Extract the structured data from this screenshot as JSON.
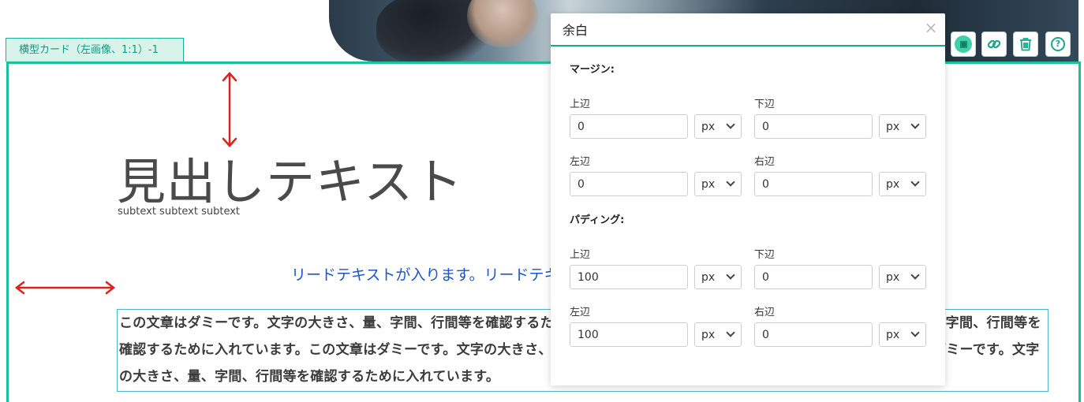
{
  "card": {
    "label": "横型カード（左画像、1:1）-1"
  },
  "content": {
    "heading": "見出しテキスト",
    "subtext": "subtext subtext subtext",
    "lead": "リードテキストが入ります。リードテキ",
    "body": "この文章はダミーです。文字の大きさ、量、字間、行間等を確認するために入れています。この文章はダミーです。文字の大きさ、量、字間、行間等を確認するために入れています。この文章はダミーです。文字の大きさ、量、字間、行間等を確認するために入れています。この文章はダミーです。文字の大きさ、量、字間、行間等を確認するために入れています。"
  },
  "toolbar": {
    "margin_icon": "margin-settings-icon",
    "link_icon": "link-icon",
    "delete_icon": "trash-icon",
    "help_label": "?"
  },
  "dialog": {
    "title": "余白",
    "close_label": "×",
    "margin": {
      "title": "マージン:",
      "top": {
        "label": "上辺",
        "value": "0",
        "unit": "px"
      },
      "bottom": {
        "label": "下辺",
        "value": "0",
        "unit": "px"
      },
      "left": {
        "label": "左辺",
        "value": "0",
        "unit": "px"
      },
      "right": {
        "label": "右辺",
        "value": "0",
        "unit": "px"
      }
    },
    "padding": {
      "title": "パディング:",
      "top": {
        "label": "上辺",
        "value": "100",
        "unit": "px"
      },
      "bottom": {
        "label": "下辺",
        "value": "0",
        "unit": "px"
      },
      "left": {
        "label": "左辺",
        "value": "100",
        "unit": "px"
      },
      "right": {
        "label": "右辺",
        "value": "0",
        "unit": "px"
      }
    }
  },
  "colors": {
    "accent": "#19c09a",
    "arrow": "#e0201a",
    "lead": "#1a56c8"
  }
}
